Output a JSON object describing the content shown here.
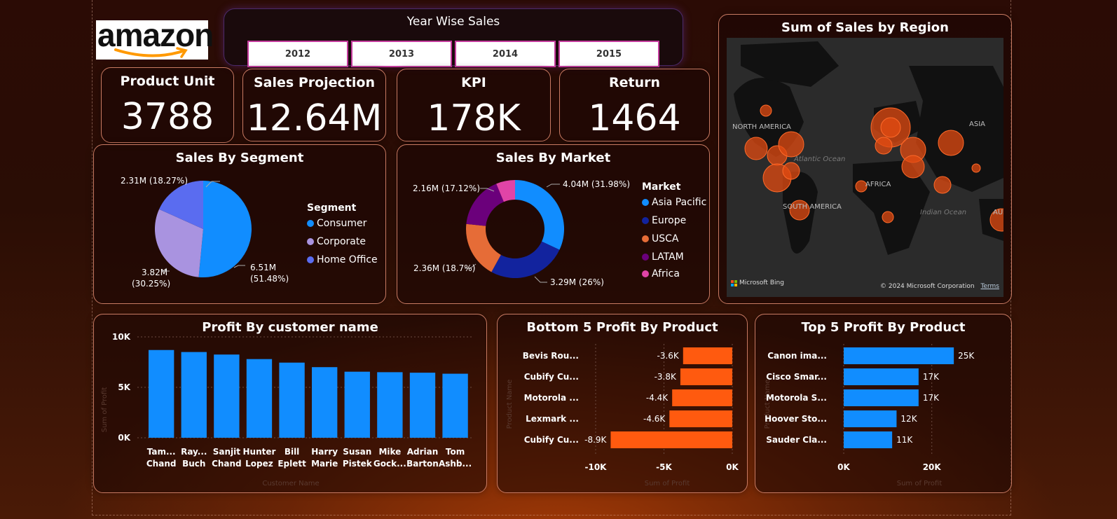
{
  "logo": {
    "text": "amazon"
  },
  "years": {
    "title": "Year Wise Sales",
    "items": [
      "2012",
      "2013",
      "2014",
      "2015"
    ]
  },
  "kpis": [
    {
      "label": "Product Unit",
      "value": "3788"
    },
    {
      "label": "Sales Projection",
      "value": "12.64M"
    },
    {
      "label": "KPI",
      "value": "178K"
    },
    {
      "label": "Return",
      "value": "1464"
    }
  ],
  "segment": {
    "title": "Sales By Segment",
    "legend_title": "Segment",
    "labels": {
      "consumer": [
        "6.51M",
        "(51.48%)"
      ],
      "corporate": [
        "3.82M",
        "(30.25%)"
      ],
      "home_office": "2.31M (18.27%)"
    }
  },
  "market": {
    "title": "Sales By Market",
    "legend_title": "Market",
    "labels": {
      "asia_pacific": "4.04M (31.98%)",
      "europe": "3.29M (26%)",
      "usca": "2.36M (18.7%)",
      "latam": "2.16M (17.12%)"
    }
  },
  "map": {
    "title": "Sum of Sales by Region",
    "labels": {
      "north_america": "NORTH AMERICA",
      "south_america": "SOUTH AMERICA",
      "africa": "AFRICA",
      "asia": "ASIA",
      "aus": "AUS",
      "atlantic": "Atlantic Ocean",
      "indian": "Indian Ocean"
    },
    "bing": "Microsoft Bing",
    "copyright": "© 2024 Microsoft Corporation",
    "terms": "Terms"
  },
  "customer": {
    "title": "Profit By customer name",
    "xlabel": "Customer Name",
    "ylabel": "Sum of Profit"
  },
  "bottom5": {
    "title": "Bottom 5 Profit By Product",
    "xlabel": "Sum of Profit",
    "ylabel": "Product Name"
  },
  "top5": {
    "title": "Top 5 Profit By Product",
    "xlabel": "Sum of Profit",
    "ylabel": "Product Name"
  },
  "colors": {
    "blue": "#118dff",
    "orange": "#ff5a0f",
    "consumer": "#118dff",
    "corporate": "#a993e0",
    "home_office": "#5a6cf0",
    "asia_pacific": "#118dff",
    "europe": "#12239e",
    "usca": "#e66c37",
    "latam": "#6b007b",
    "africa": "#e044a7"
  },
  "chart_data": [
    {
      "type": "pie",
      "title": "Sales By Segment",
      "legend": "Segment",
      "categories": [
        "Consumer",
        "Corporate",
        "Home Office"
      ],
      "values": [
        6.51,
        3.82,
        2.31
      ],
      "percent": [
        51.48,
        30.25,
        18.27
      ],
      "unit": "M"
    },
    {
      "type": "pie",
      "title": "Sales By Market",
      "legend": "Market",
      "categories": [
        "Asia Pacific",
        "Europe",
        "USCA",
        "LATAM",
        "Africa"
      ],
      "values": [
        4.04,
        3.29,
        2.36,
        2.16,
        0.79
      ],
      "percent": [
        31.98,
        26,
        18.7,
        17.12,
        6.2
      ],
      "unit": "M"
    },
    {
      "type": "bar",
      "title": "Profit By customer name",
      "xlabel": "Customer Name",
      "ylabel": "Sum of Profit",
      "categories": [
        [
          "Tam...",
          "Chand"
        ],
        [
          "Ray...",
          "Buch"
        ],
        [
          "Sanjit",
          "Chand"
        ],
        [
          "Hunter",
          "Lopez"
        ],
        [
          "Bill",
          "Eplett"
        ],
        [
          "Harry",
          "Marie"
        ],
        [
          "Susan",
          "Pistek"
        ],
        [
          "Mike",
          "Gock..."
        ],
        [
          "Adrian",
          "Barton"
        ],
        [
          "Tom",
          "Ashb..."
        ]
      ],
      "values": [
        8700,
        8500,
        8250,
        7800,
        7450,
        7000,
        6550,
        6500,
        6450,
        6350
      ],
      "ylim": [
        0,
        10000
      ],
      "yticks": [
        {
          "v": 10000,
          "t": "10K"
        },
        {
          "v": 5000,
          "t": "5K"
        },
        {
          "v": 0,
          "t": "0K"
        }
      ]
    },
    {
      "type": "bar",
      "orientation": "horizontal",
      "title": "Bottom 5 Profit By Product",
      "xlabel": "Sum of Profit",
      "ylabel": "Product Name",
      "categories": [
        "Bevis Rou...",
        "Cubify Cu...",
        "Motorola ...",
        "Lexmark ...",
        "Cubify Cu..."
      ],
      "values": [
        -3600,
        -3800,
        -4400,
        -4600,
        -8900
      ],
      "labels": [
        "-3.6K",
        "-3.8K",
        "-4.4K",
        "-4.6K",
        "-8.9K"
      ],
      "xlim": [
        -10000,
        0
      ],
      "xticks": [
        {
          "v": -10000,
          "t": "-10K"
        },
        {
          "v": -5000,
          "t": "-5K"
        },
        {
          "v": 0,
          "t": "0K"
        }
      ]
    },
    {
      "type": "bar",
      "orientation": "horizontal",
      "title": "Top 5 Profit By Product",
      "xlabel": "Sum of Profit",
      "ylabel": "Product Name",
      "categories": [
        "Canon ima...",
        "Cisco Smar...",
        "Motorola S...",
        "Hoover Sto...",
        "Sauder Cla..."
      ],
      "values": [
        25000,
        17000,
        17000,
        12000,
        11000
      ],
      "labels": [
        "25K",
        "17K",
        "17K",
        "12K",
        "11K"
      ],
      "xlim": [
        0,
        28000
      ],
      "xticks": [
        {
          "v": 0,
          "t": "0K"
        },
        {
          "v": 20000,
          "t": "20K"
        }
      ]
    }
  ]
}
